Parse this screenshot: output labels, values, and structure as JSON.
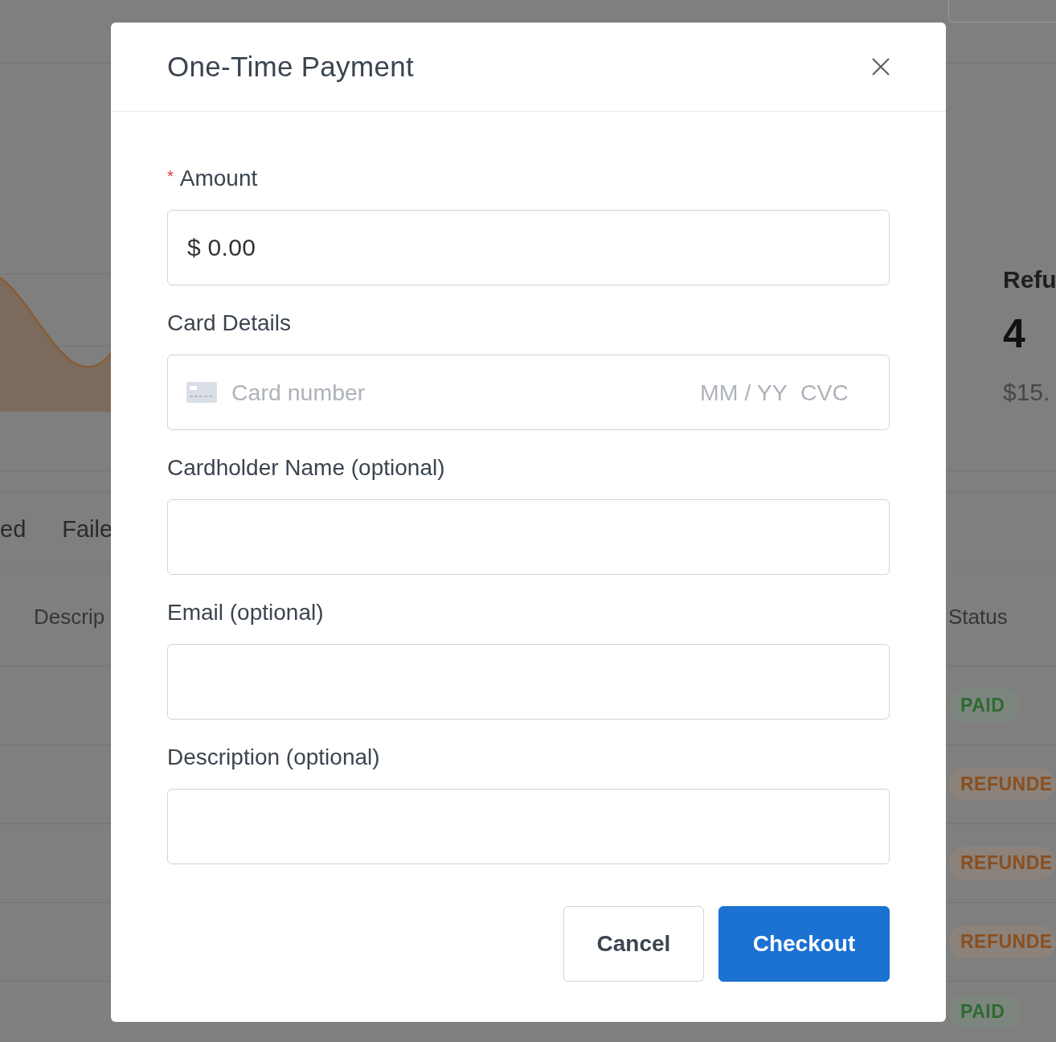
{
  "background": {
    "summary": {
      "label": "Refu",
      "count": "4",
      "amount": "$15."
    },
    "tabs": [
      {
        "label": "ed",
        "selected": false
      },
      {
        "label": "Faile",
        "selected": false
      }
    ],
    "table": {
      "columns": [
        "Descrip",
        "Status"
      ],
      "rows": [
        {
          "status": "PAID",
          "color": "#2f6a31"
        },
        {
          "status": "REFUNDE",
          "color": "#8a4f20"
        },
        {
          "status": "REFUNDE",
          "color": "#8a4f20"
        },
        {
          "status": "REFUNDE",
          "color": "#8a4f20"
        },
        {
          "status": "PAID",
          "color": "#2f6a31"
        }
      ]
    }
  },
  "modal": {
    "title": "One-Time Payment",
    "fields": [
      {
        "kind": "text",
        "label": "Amount",
        "required_mark": "*",
        "value": "$ 0.00"
      },
      {
        "kind": "card",
        "label": "Card Details",
        "inputs": [
          {
            "placeholder": "Card number"
          },
          {
            "placeholder": "MM / YY"
          },
          {
            "placeholder": "CVC"
          }
        ]
      },
      {
        "kind": "text",
        "label": "Cardholder Name (optional)"
      },
      {
        "kind": "text",
        "label": "Email (optional)"
      },
      {
        "kind": "text",
        "label": "Description (optional)"
      }
    ],
    "buttons": [
      {
        "label": "Cancel",
        "kind": "secondary"
      },
      {
        "label": "Checkout",
        "kind": "primary"
      }
    ]
  }
}
